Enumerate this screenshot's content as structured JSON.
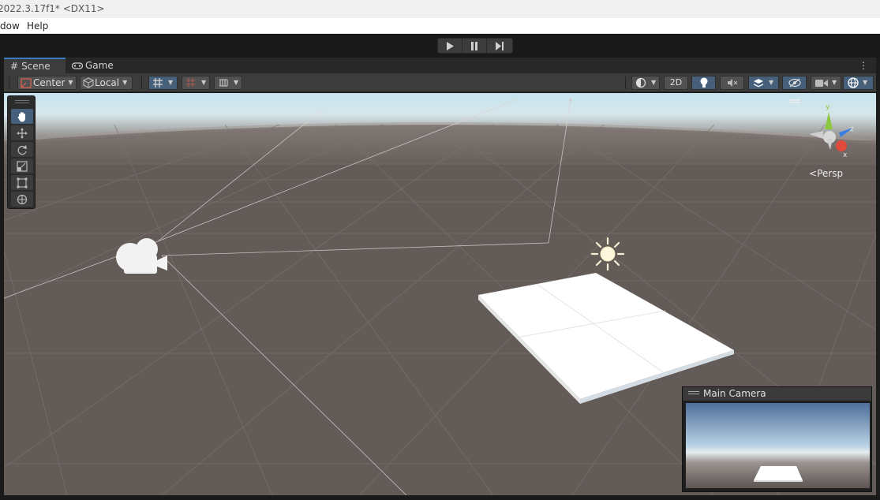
{
  "window": {
    "title": "2022.3.17f1* <DX11>"
  },
  "menu": {
    "items": [
      "dow",
      "Help"
    ]
  },
  "tabs": [
    {
      "label": "Scene",
      "icon": "grid-icon",
      "active": true
    },
    {
      "label": "Game",
      "icon": "gamepad-icon",
      "active": false
    }
  ],
  "toolbar": {
    "pivot_label": "Center",
    "space_label": "Local",
    "mode_2d_label": "2D"
  },
  "viewport": {
    "projection_label": "Persp",
    "gizmo_axes": [
      "y",
      "z",
      "x"
    ]
  },
  "camera_preview": {
    "title": "Main Camera"
  },
  "colors": {
    "accent": "#46607c",
    "tab_highlight": "#3a79bb",
    "ground": "#635b57",
    "sky_top": "#c6e4ee",
    "axis_y": "#8dc63f",
    "axis_z": "#3a7ee6",
    "axis_x": "#e04a3a"
  }
}
